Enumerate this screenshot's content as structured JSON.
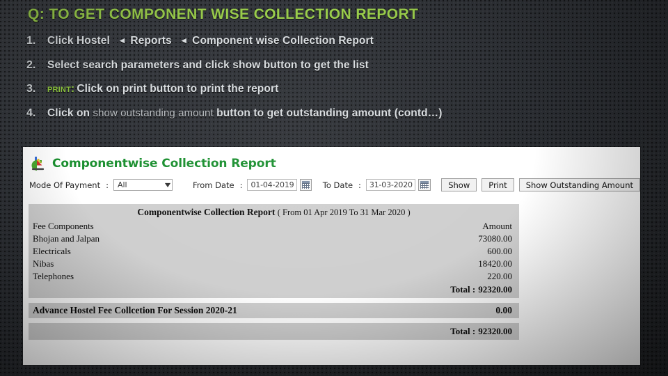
{
  "slide": {
    "title": "Q: TO GET COMPONENT WISE COLLECTION REPORT",
    "title_color": "#99cc4b",
    "background_color": "#303337",
    "steps": [
      {
        "number": "1.",
        "parts": [
          {
            "text": "Click Hostel",
            "style": "bold"
          },
          {
            "text": "◂",
            "style": "arrow"
          },
          {
            "text": "Reports",
            "style": "bold"
          },
          {
            "text": "◂",
            "style": "arrow"
          },
          {
            "text": "Component wise",
            "style": "bold"
          },
          {
            "text": "Collection  Report",
            "style": "bold"
          }
        ]
      },
      {
        "number": "2.",
        "parts": [
          {
            "text": "Select search parameters and click show button   to get the list",
            "style": "bold"
          }
        ]
      },
      {
        "number": "3.",
        "parts": [
          {
            "text": "Print:",
            "style": "smallcaps-green"
          },
          {
            "text": "Click on print button  to print  the report",
            "style": "bold"
          }
        ]
      },
      {
        "number": "4.",
        "parts": [
          {
            "text": "Click on ",
            "style": "bold"
          },
          {
            "text": "show outstanding amount",
            "style": "thin"
          },
          {
            "text": "   button to get outstanding amount (contd…)",
            "style": "bold"
          }
        ]
      }
    ]
  },
  "app": {
    "window_title": "Componentwise Collection Report",
    "title_icon": "pie-chart-icon",
    "toolbar": {
      "mode_label": "Mode Of Payment",
      "mode_colon": ":",
      "mode_value": "All",
      "mode_caret": "▼",
      "from_label": "From Date",
      "from_colon": ":",
      "from_value": "01-04-2019",
      "to_label": "To Date",
      "to_colon": ":",
      "to_value": "31-03-2020",
      "calendar_icon": "calendar-icon",
      "show_button": "Show",
      "print_button": "Print",
      "outstanding_button": "Show Outstanding Amount"
    },
    "report": {
      "title_bold": "Componentwise Collection Report",
      "title_range": "( From 01 Apr 2019 To 31 Mar 2020 )",
      "col_component": "Fee Components",
      "col_amount": "Amount",
      "rows": [
        {
          "component": "Bhojan and Jalpan",
          "amount": "73080.00"
        },
        {
          "component": "Electricals",
          "amount": "600.00"
        },
        {
          "component": "Nibas",
          "amount": "18420.00"
        },
        {
          "component": "Telephones",
          "amount": "220.00"
        }
      ],
      "total_label": "Total :",
      "total_value": "92320.00",
      "advance_label": "Advance Hostel Fee Collcetion For Session 2020-21",
      "advance_value": "0.00",
      "grand_total_label": "Total :",
      "grand_total_value": "92320.00"
    }
  }
}
